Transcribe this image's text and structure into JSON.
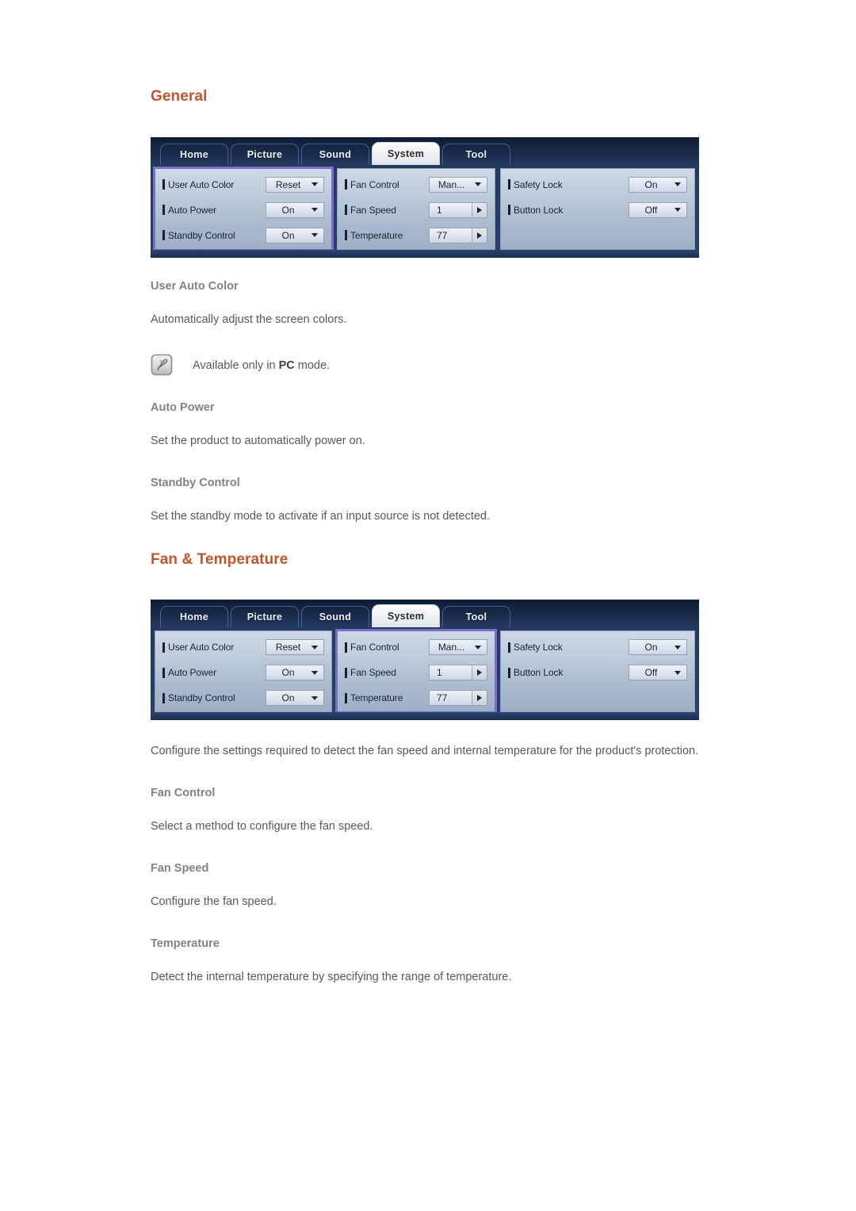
{
  "sections": [
    {
      "heading": "General",
      "osd": {
        "tabs": [
          {
            "label": "Home",
            "active": false
          },
          {
            "label": "Picture",
            "active": false
          },
          {
            "label": "Sound",
            "active": false
          },
          {
            "label": "System",
            "active": true
          },
          {
            "label": "Tool",
            "active": false
          }
        ],
        "highlighted_column": 0,
        "columns": [
          {
            "rows": [
              {
                "label": "User Auto Color",
                "value": "Reset",
                "control": "dropdown"
              },
              {
                "label": "Auto Power",
                "value": "On",
                "control": "dropdown"
              },
              {
                "label": "Standby Control",
                "value": "On",
                "control": "dropdown"
              }
            ]
          },
          {
            "rows": [
              {
                "label": "Fan Control",
                "value": "Man...",
                "control": "dropdown"
              },
              {
                "label": "Fan Speed",
                "value": "1",
                "control": "stepper"
              },
              {
                "label": "Temperature",
                "value": "77",
                "control": "stepper"
              }
            ]
          },
          {
            "rows": [
              {
                "label": "Safety Lock",
                "value": "On",
                "control": "dropdown"
              },
              {
                "label": "Button Lock",
                "value": "Off",
                "control": "dropdown"
              }
            ]
          }
        ]
      },
      "blocks": [
        {
          "type": "subheading",
          "text": "User Auto Color"
        },
        {
          "type": "paragraph",
          "text": "Automatically adjust the screen colors."
        },
        {
          "type": "note",
          "icon": "note-pen-icon",
          "prefix": "Available only in ",
          "bold": "PC",
          "suffix": " mode."
        },
        {
          "type": "subheading",
          "text": "Auto Power"
        },
        {
          "type": "paragraph",
          "text": "Set the product to automatically power on."
        },
        {
          "type": "subheading",
          "text": "Standby Control"
        },
        {
          "type": "paragraph",
          "text": "Set the standby mode to activate if an input source is not detected."
        }
      ]
    },
    {
      "heading": "Fan & Temperature",
      "osd": {
        "tabs": [
          {
            "label": "Home",
            "active": false
          },
          {
            "label": "Picture",
            "active": false
          },
          {
            "label": "Sound",
            "active": false
          },
          {
            "label": "System",
            "active": true
          },
          {
            "label": "Tool",
            "active": false
          }
        ],
        "highlighted_column": 1,
        "columns": [
          {
            "rows": [
              {
                "label": "User Auto Color",
                "value": "Reset",
                "control": "dropdown"
              },
              {
                "label": "Auto Power",
                "value": "On",
                "control": "dropdown"
              },
              {
                "label": "Standby Control",
                "value": "On",
                "control": "dropdown"
              }
            ]
          },
          {
            "rows": [
              {
                "label": "Fan Control",
                "value": "Man...",
                "control": "dropdown"
              },
              {
                "label": "Fan Speed",
                "value": "1",
                "control": "stepper"
              },
              {
                "label": "Temperature",
                "value": "77",
                "control": "stepper"
              }
            ]
          },
          {
            "rows": [
              {
                "label": "Safety Lock",
                "value": "On",
                "control": "dropdown"
              },
              {
                "label": "Button Lock",
                "value": "Off",
                "control": "dropdown"
              }
            ]
          }
        ]
      },
      "blocks": [
        {
          "type": "paragraph",
          "text": "Configure the settings required to detect the fan speed and internal temperature for the product's protection."
        },
        {
          "type": "subheading",
          "text": "Fan Control"
        },
        {
          "type": "paragraph",
          "text": "Select a method to configure the fan speed."
        },
        {
          "type": "subheading",
          "text": "Fan Speed"
        },
        {
          "type": "paragraph",
          "text": "Configure the fan speed."
        },
        {
          "type": "subheading",
          "text": "Temperature"
        },
        {
          "type": "paragraph",
          "text": "Detect the internal temperature by specifying the range of temperature."
        }
      ]
    }
  ],
  "colors": {
    "heading_rust": "#c2552b",
    "subheading_grey": "#808285",
    "body_grey": "#58595b",
    "osd_highlight_purple": "#7a6fc4",
    "osd_chrome_navy": "#1d3153"
  }
}
